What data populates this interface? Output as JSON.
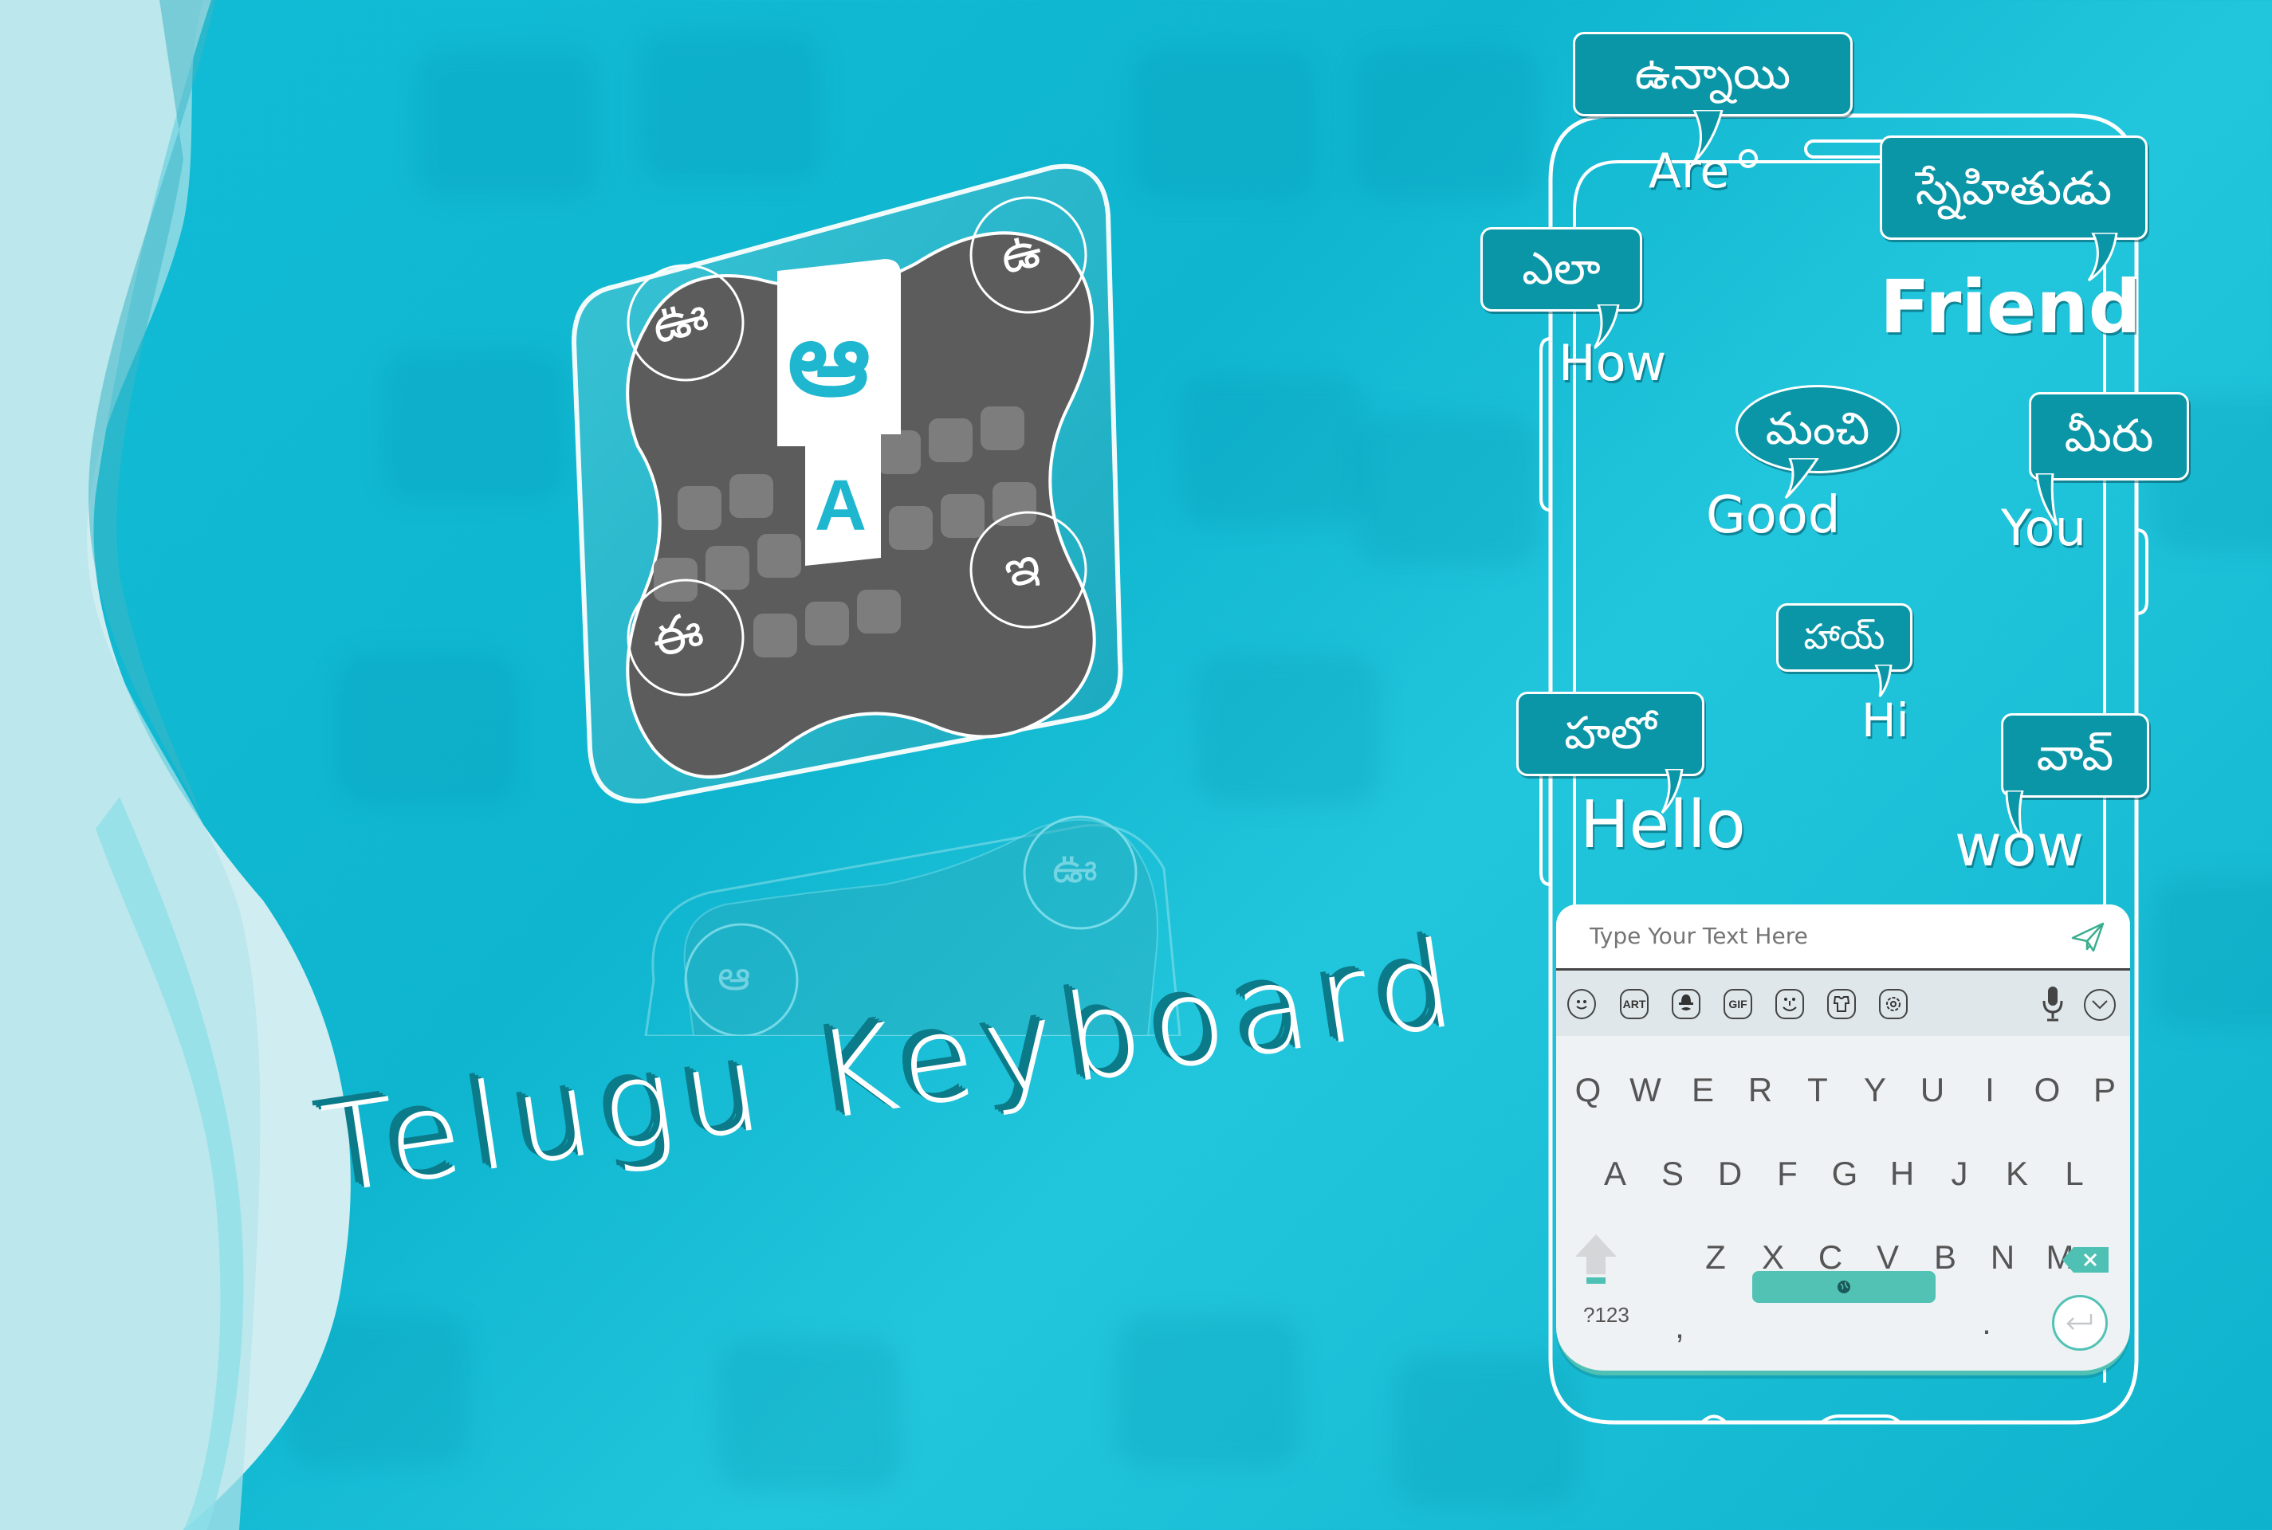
{
  "banner": {
    "title": "Telugu Keyboard"
  },
  "app_icon": {
    "corner_glyphs": {
      "top_left": "ఊ",
      "top_right": "ఉ",
      "bottom_left": "ఈ",
      "bottom_right": "ఇ"
    },
    "center_key": {
      "telugu": "ఆ",
      "latin": "A"
    },
    "reflection_glyphs": [
      "ఆ",
      "ఊ"
    ]
  },
  "phone": {
    "translations": [
      {
        "english": "Are",
        "telugu": "ఉన్నాయి"
      },
      {
        "english": "Friend",
        "telugu": "స్నేహితుడు"
      },
      {
        "english": "How",
        "telugu": "ఎలా"
      },
      {
        "english": "Good",
        "telugu": "మంచి"
      },
      {
        "english": "You",
        "telugu": "మీరు"
      },
      {
        "english": "Hi",
        "telugu": "హాయ్"
      },
      {
        "english": "Hello",
        "telugu": "హలో"
      },
      {
        "english": "wow",
        "telugu": "వావ్"
      }
    ],
    "keyboard": {
      "input_placeholder": "Type Your Text Here",
      "send_icon": "paper-plane-icon",
      "toolbar": [
        {
          "icon": "emoji-icon",
          "label": ""
        },
        {
          "icon": "art-icon",
          "label": "ART"
        },
        {
          "icon": "sticker-icon",
          "label": ""
        },
        {
          "icon": "gif-icon",
          "label": "GIF"
        },
        {
          "icon": "face-icon",
          "label": ""
        },
        {
          "icon": "theme-icon",
          "label": ""
        },
        {
          "icon": "settings-icon",
          "label": ""
        },
        {
          "icon": "microphone-icon",
          "label": ""
        },
        {
          "icon": "collapse-icon",
          "label": ""
        }
      ],
      "rows": [
        [
          "Q",
          "W",
          "E",
          "R",
          "T",
          "Y",
          "U",
          "I",
          "O",
          "P"
        ],
        [
          "A",
          "S",
          "D",
          "F",
          "G",
          "H",
          "J",
          "K",
          "L"
        ],
        [
          "Z",
          "X",
          "C",
          "V",
          "B",
          "N",
          "M"
        ]
      ],
      "symbols_key": "?123",
      "comma_key": ",",
      "period_key": ".",
      "accent_color": "#52c2b5"
    }
  },
  "colors": {
    "background": "#12bcd6",
    "bubble": "#0a96a6",
    "title_shadow": "#0b7a89",
    "icon_body": "#5a5a5a"
  }
}
